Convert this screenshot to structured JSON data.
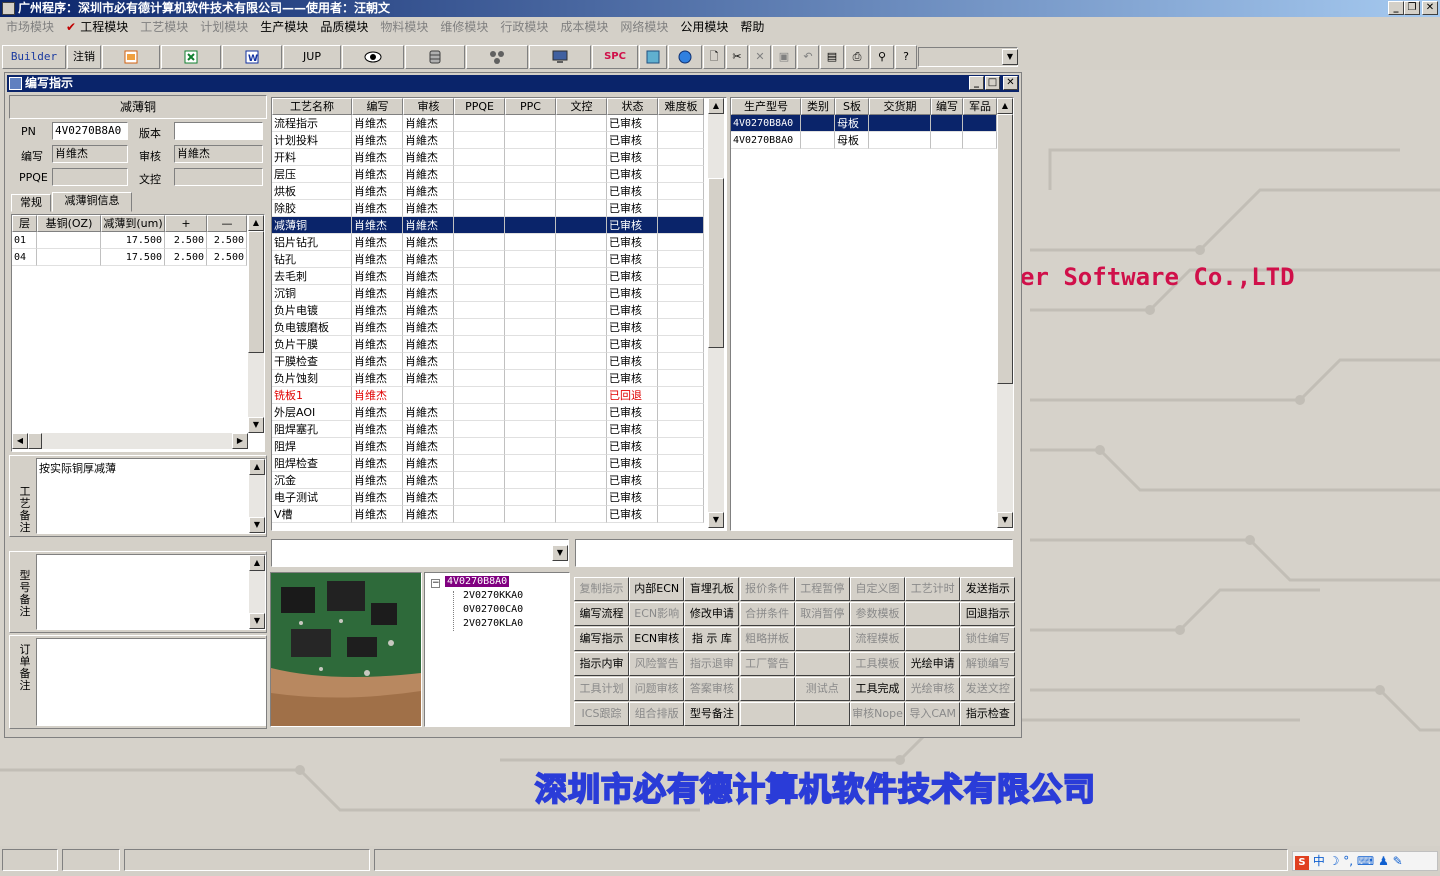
{
  "window": {
    "title": "广州程序：深圳市必有德计算机软件技术有限公司——使用者：汪朝文"
  },
  "menu": {
    "items": [
      {
        "label": "市场模块",
        "enabled": false
      },
      {
        "label": "工程模块",
        "enabled": true,
        "checked": true
      },
      {
        "label": "工艺模块",
        "enabled": false
      },
      {
        "label": "计划模块",
        "enabled": false
      },
      {
        "label": "生产模块",
        "enabled": true
      },
      {
        "label": "品质模块",
        "enabled": true
      },
      {
        "label": "物料模块",
        "enabled": false
      },
      {
        "label": "维修模块",
        "enabled": false
      },
      {
        "label": "行政模块",
        "enabled": false
      },
      {
        "label": "成本模块",
        "enabled": false
      },
      {
        "label": "网络模块",
        "enabled": false
      },
      {
        "label": "公用模块",
        "enabled": true
      },
      {
        "label": "帮助",
        "enabled": true
      }
    ]
  },
  "toolbar": {
    "builder": "Builder",
    "logout": "注销",
    "jup": "JUP",
    "spc": "SPC",
    "icons": [
      "powerpoint-icon",
      "excel-icon",
      "word-icon",
      "eye-icon",
      "database-icon",
      "network-icon",
      "monitor-icon",
      "world-icon",
      "globe-icon",
      "new-doc-icon",
      "cut-icon",
      "delete-icon",
      "save-icon",
      "undo-icon",
      "preview-icon",
      "print-icon",
      "find-icon",
      "help-icon"
    ]
  },
  "child": {
    "title": "编写指示"
  },
  "left": {
    "heading": "减薄铜",
    "pn_label": "PN",
    "pn_value": "4V0270B8A0",
    "version_label": "版本",
    "version_value": "",
    "writer_label": "编写",
    "writer_value": "肖维杰",
    "reviewer_label": "审核",
    "reviewer_value": "肖維杰",
    "ppqe_label": "PPQE",
    "ppqe_value": "",
    "doc_label": "文控",
    "doc_value": "",
    "tabs": [
      "常规",
      "减薄铜信息"
    ],
    "layer_grid": {
      "headers": [
        "层",
        "基铜(OZ)",
        "减薄到(um)",
        "+",
        "—"
      ],
      "rows": [
        [
          "01",
          "",
          "17.500",
          "2.500",
          "2.500"
        ],
        [
          "04",
          "",
          "17.500",
          "2.500",
          "2.500"
        ]
      ]
    },
    "process_note_label": "工艺备注",
    "process_note": "按实际铜厚减薄",
    "model_note_label": "型号备注",
    "model_note": "",
    "order_note_label": "订单备注",
    "order_note": ""
  },
  "process_grid": {
    "headers": [
      "工艺名称",
      "编写",
      "审核",
      "PPQE",
      "PPC",
      "文控",
      "状态",
      "难度板"
    ],
    "rows": [
      {
        "name": "流程指示",
        "writer": "肖维杰",
        "reviewer": "肖維杰",
        "ppqe": "",
        "ppc": "",
        "doc": "",
        "status": "已审核",
        "diff": ""
      },
      {
        "name": "计划投料",
        "writer": "肖维杰",
        "reviewer": "肖維杰",
        "ppqe": "",
        "ppc": "",
        "doc": "",
        "status": "已审核",
        "diff": ""
      },
      {
        "name": "开料",
        "writer": "肖维杰",
        "reviewer": "肖維杰",
        "ppqe": "",
        "ppc": "",
        "doc": "",
        "status": "已审核",
        "diff": ""
      },
      {
        "name": "层压",
        "writer": "肖维杰",
        "reviewer": "肖維杰",
        "ppqe": "",
        "ppc": "",
        "doc": "",
        "status": "已审核",
        "diff": ""
      },
      {
        "name": "烘板",
        "writer": "肖维杰",
        "reviewer": "肖維杰",
        "ppqe": "",
        "ppc": "",
        "doc": "",
        "status": "已审核",
        "diff": ""
      },
      {
        "name": "除胶",
        "writer": "肖维杰",
        "reviewer": "肖維杰",
        "ppqe": "",
        "ppc": "",
        "doc": "",
        "status": "已审核",
        "diff": ""
      },
      {
        "name": "减薄铜",
        "writer": "肖维杰",
        "reviewer": "肖維杰",
        "ppqe": "",
        "ppc": "",
        "doc": "",
        "status": "已审核",
        "diff": "",
        "selected": true
      },
      {
        "name": "铝片钻孔",
        "writer": "肖维杰",
        "reviewer": "肖維杰",
        "ppqe": "",
        "ppc": "",
        "doc": "",
        "status": "已审核",
        "diff": ""
      },
      {
        "name": "钻孔",
        "writer": "肖维杰",
        "reviewer": "肖維杰",
        "ppqe": "",
        "ppc": "",
        "doc": "",
        "status": "已审核",
        "diff": ""
      },
      {
        "name": "去毛刺",
        "writer": "肖维杰",
        "reviewer": "肖維杰",
        "ppqe": "",
        "ppc": "",
        "doc": "",
        "status": "已审核",
        "diff": ""
      },
      {
        "name": "沉铜",
        "writer": "肖维杰",
        "reviewer": "肖維杰",
        "ppqe": "",
        "ppc": "",
        "doc": "",
        "status": "已审核",
        "diff": ""
      },
      {
        "name": "负片电镀",
        "writer": "肖维杰",
        "reviewer": "肖維杰",
        "ppqe": "",
        "ppc": "",
        "doc": "",
        "status": "已审核",
        "diff": ""
      },
      {
        "name": "负电镀磨板",
        "writer": "肖维杰",
        "reviewer": "肖維杰",
        "ppqe": "",
        "ppc": "",
        "doc": "",
        "status": "已审核",
        "diff": ""
      },
      {
        "name": "负片干膜",
        "writer": "肖维杰",
        "reviewer": "肖維杰",
        "ppqe": "",
        "ppc": "",
        "doc": "",
        "status": "已审核",
        "diff": ""
      },
      {
        "name": "干膜检查",
        "writer": "肖维杰",
        "reviewer": "肖維杰",
        "ppqe": "",
        "ppc": "",
        "doc": "",
        "status": "已审核",
        "diff": ""
      },
      {
        "name": "负片蚀刻",
        "writer": "肖维杰",
        "reviewer": "肖維杰",
        "ppqe": "",
        "ppc": "",
        "doc": "",
        "status": "已审核",
        "diff": ""
      },
      {
        "name": "铣板1",
        "writer": "肖维杰",
        "reviewer": "",
        "ppqe": "",
        "ppc": "",
        "doc": "",
        "status": "已回退",
        "diff": "",
        "red": true
      },
      {
        "name": "外层AOI",
        "writer": "肖维杰",
        "reviewer": "肖維杰",
        "ppqe": "",
        "ppc": "",
        "doc": "",
        "status": "已审核",
        "diff": ""
      },
      {
        "name": "阻焊塞孔",
        "writer": "肖维杰",
        "reviewer": "肖維杰",
        "ppqe": "",
        "ppc": "",
        "doc": "",
        "status": "已审核",
        "diff": ""
      },
      {
        "name": "阻焊",
        "writer": "肖维杰",
        "reviewer": "肖維杰",
        "ppqe": "",
        "ppc": "",
        "doc": "",
        "status": "已审核",
        "diff": ""
      },
      {
        "name": "阻焊检查",
        "writer": "肖维杰",
        "reviewer": "肖維杰",
        "ppqe": "",
        "ppc": "",
        "doc": "",
        "status": "已审核",
        "diff": ""
      },
      {
        "name": "沉金",
        "writer": "肖维杰",
        "reviewer": "肖維杰",
        "ppqe": "",
        "ppc": "",
        "doc": "",
        "status": "已审核",
        "diff": ""
      },
      {
        "name": "电子测试",
        "writer": "肖维杰",
        "reviewer": "肖維杰",
        "ppqe": "",
        "ppc": "",
        "doc": "",
        "status": "已审核",
        "diff": ""
      },
      {
        "name": "V槽",
        "writer": "肖维杰",
        "reviewer": "肖維杰",
        "ppqe": "",
        "ppc": "",
        "doc": "",
        "status": "已审核",
        "diff": ""
      }
    ]
  },
  "model_grid": {
    "headers": [
      "生产型号",
      "类别",
      "S板",
      "交货期",
      "编写",
      "军品"
    ],
    "rows": [
      {
        "model": "4V0270B8A0",
        "type": "",
        "s": "母板",
        "date": "",
        "writer": "",
        "mil": "",
        "selected": true
      },
      {
        "model": "4V0270B8A0",
        "type": "",
        "s": "母板",
        "date": "",
        "writer": "",
        "mil": ""
      }
    ]
  },
  "tree": {
    "root": "4V0270B8A0",
    "children": [
      "2V0270KKA0",
      "0V02700CA0",
      "2V0270KLA0"
    ]
  },
  "actions": [
    [
      "复制指示",
      "内部ECN",
      "盲埋孔板",
      "报价条件",
      "工程暂停",
      "自定义图",
      "工艺计时",
      "发送指示"
    ],
    [
      "编写流程",
      "ECN影响",
      "修改申请",
      "合拼条件",
      "取消暂停",
      "参数模板",
      "",
      "回退指示"
    ],
    [
      "编写指示",
      "ECN审核",
      "指 示 库",
      "粗略拼板",
      "",
      "流程模板",
      "",
      "锁住编写"
    ],
    [
      "指示内审",
      "风险警告",
      "指示退审",
      "工厂警告",
      "",
      "工具模板",
      "光绘申请",
      "解锁编写"
    ],
    [
      "工具计划",
      "问题审核",
      "答案审核",
      "",
      "测试点",
      "工具完成",
      "光绘审核",
      "发送文控"
    ],
    [
      "ICS跟踪",
      "组合排版",
      "型号备注",
      "",
      "",
      "审核Nope",
      "导入CAM",
      "指示检查"
    ]
  ],
  "actions_disabled": [
    [
      true,
      false,
      false,
      true,
      true,
      true,
      true,
      false
    ],
    [
      false,
      true,
      false,
      true,
      true,
      true,
      false,
      false
    ],
    [
      false,
      false,
      false,
      true,
      false,
      true,
      false,
      true
    ],
    [
      false,
      true,
      true,
      true,
      false,
      true,
      false,
      true
    ],
    [
      true,
      true,
      true,
      false,
      true,
      false,
      true,
      true
    ],
    [
      true,
      true,
      false,
      false,
      false,
      true,
      true,
      false
    ]
  ],
  "background": {
    "company_en": "er Software Co.,LTD",
    "company_cn": "深圳市必有德计算机软件技术有限公司"
  },
  "tray": {
    "ime": "中"
  },
  "colors": {
    "selection": "#0a246a",
    "title_start": "#0a246a",
    "title_end": "#a6caf0",
    "red_status": "#e00000",
    "brand_red": "#d0104a",
    "brand_blue": "#2a3cd8"
  }
}
